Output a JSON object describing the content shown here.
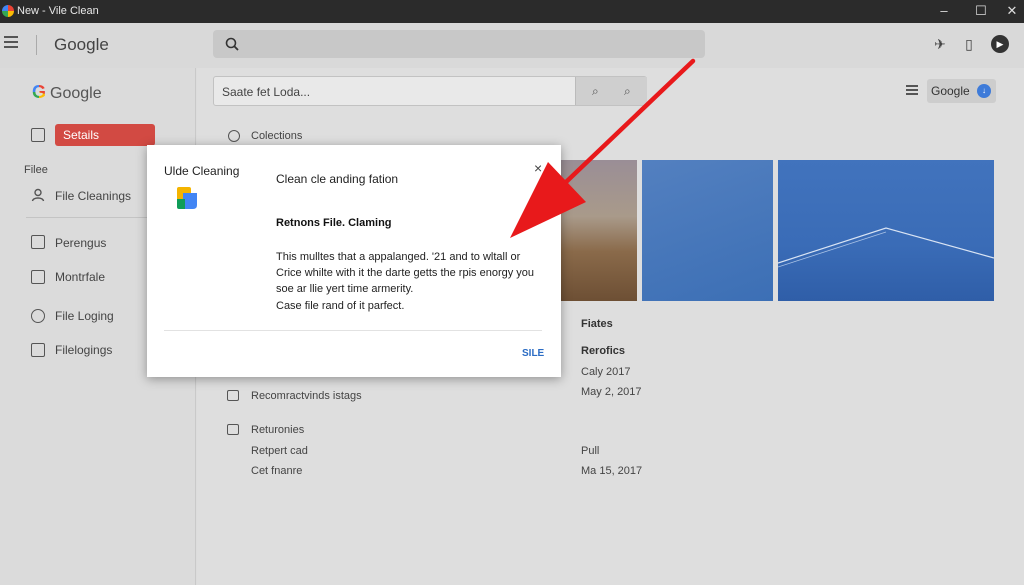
{
  "window": {
    "title": "New - Vile Clean"
  },
  "topbar": {
    "brand": "Google"
  },
  "sidebar": {
    "logo": "Google",
    "selected": "Setails",
    "section": "Filee",
    "items": [
      "File Cleanings",
      "Perengus",
      "Montrfale",
      "File Loging",
      "Filelogings"
    ]
  },
  "main": {
    "search_value": "Saate fet Loda...",
    "chip_label": "Google",
    "collections": "Colections",
    "rows": {
      "recommendations": "Recomractvinds istags",
      "returnies": "Returonies",
      "retpert": "Retpert cad",
      "cet": "Cet fnanre"
    },
    "right_col": {
      "fiates": "Fiates",
      "reroflcs": "Rerofics",
      "date1": "Caly 2017",
      "date2": "May 2, 2017",
      "pull": "Pull",
      "date3": "Ma 15, 2017"
    }
  },
  "dialog": {
    "app_name": "Ulde Cleaning",
    "heading": "Clean cle anding fation",
    "subheading": "Retnons File. Claming",
    "body1": "This mulltes that a appalanged. '21 and to wltall or",
    "body2": "Crice whilte with it the darte getts the rpis enorgy you",
    "body3": "soe ar llie yert time armerity.",
    "body4": "Case file rand of it parfect.",
    "close": "×",
    "button": "SILE"
  },
  "colors": {
    "accent_red": "#d24a43",
    "arrow": "#e8191b",
    "link": "#2b6cc4"
  }
}
